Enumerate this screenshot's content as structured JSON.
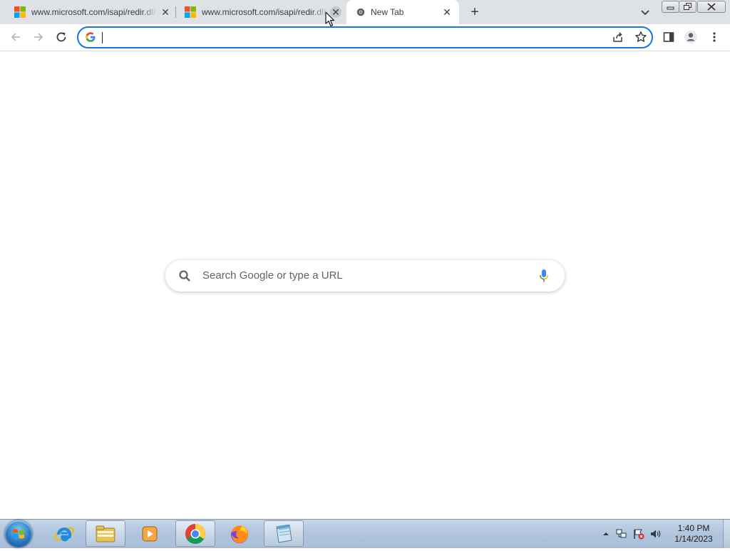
{
  "browser": {
    "tabs": [
      {
        "title": "www.microsoft.com/isapi/redir.dll?prd=ie&ar=iesearch",
        "favicon": "microsoft-logo-icon",
        "active": false
      },
      {
        "title": "www.microsoft.com/isapi/redir.dll?prd=ie&ar=iesearch",
        "favicon": "microsoft-logo-icon",
        "active": false
      },
      {
        "title": "New Tab",
        "favicon": "chrome-newtab-icon",
        "active": true
      }
    ],
    "close_glyph": "✕",
    "new_tab_glyph": "+",
    "omnibox": {
      "value": "",
      "placeholder": ""
    },
    "toolbar_icons": [
      "back-arrow-icon",
      "forward-arrow-icon",
      "reload-icon",
      "share-icon",
      "star-icon",
      "side-panel-icon",
      "profile-icon",
      "menu-dots-icon"
    ]
  },
  "ntp": {
    "search_placeholder": "Search Google or type a URL"
  },
  "taskbar": {
    "pinned": [
      "internet-explorer-icon",
      "file-explorer-icon",
      "media-player-icon",
      "chrome-icon",
      "firefox-icon",
      "notepad-icon"
    ],
    "clock_time": "1:40 PM",
    "clock_date": "1/14/2023"
  },
  "colors": {
    "accent": "#1a73e8",
    "tabstrip_bg": "#dee1e6",
    "taskbar_bg": "#b3c7de"
  }
}
